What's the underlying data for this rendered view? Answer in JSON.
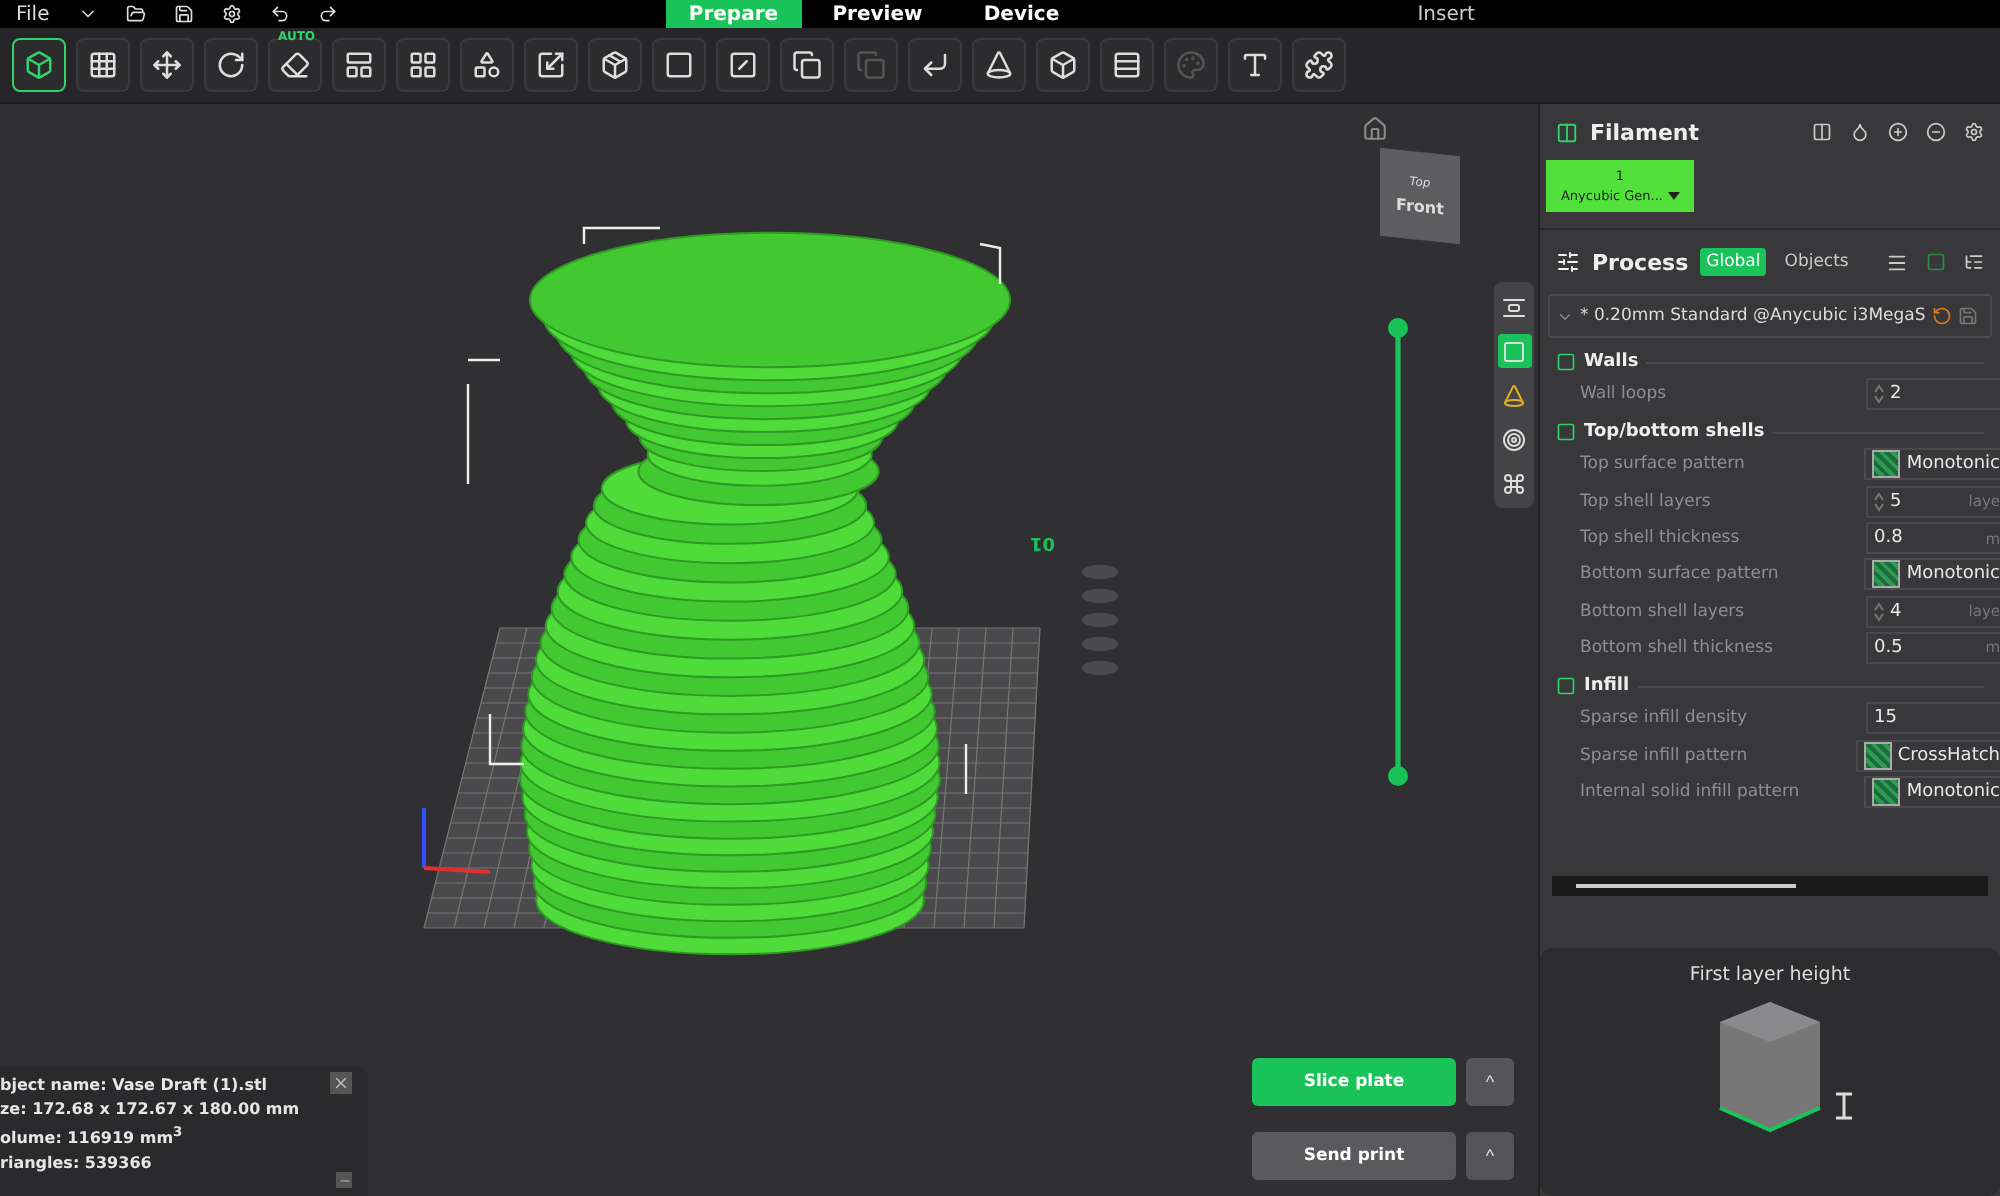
{
  "menu_bar": {
    "file_menu": "File",
    "tabs": [
      {
        "label": "Prepare",
        "selected": true
      },
      {
        "label": "Preview",
        "selected": false
      },
      {
        "label": "Device",
        "selected": false
      }
    ],
    "insert": "Insert"
  },
  "toolbar": [
    {
      "selected": true
    },
    {
      "selected": false
    },
    {
      "selected": false
    },
    {
      "selected": false
    },
    {
      "selected": false,
      "badge": "AUTO"
    },
    {
      "selected": false
    },
    {
      "selected": false
    },
    {
      "selected": false
    },
    {
      "selected": false
    },
    {
      "selected": false
    },
    {
      "selected": false
    },
    {
      "selected": false
    },
    {
      "selected": false
    },
    {
      "selected": false,
      "disabled": true
    },
    {
      "selected": false
    },
    {
      "selected": false
    },
    {
      "selected": false
    },
    {
      "selected": false
    },
    {
      "selected": false,
      "disabled": true
    },
    {
      "selected": false
    },
    {
      "selected": false
    }
  ],
  "viewport": {
    "view_cube": {
      "top": "Top",
      "front": "Front"
    },
    "plate_number": "01",
    "layer_slider": {
      "level": 1
    },
    "side_toolbar": [
      {
        "selected": false
      },
      {
        "selected": true
      },
      {
        "selected": false
      },
      {
        "selected": false
      },
      {
        "selected": false
      }
    ],
    "object_info": [
      "bject name: Vase Draft (1).stl",
      "ze: 172.68 x 172.67 x 180.00 mm",
      "olume: 116919 mm$^{3}$",
      "riangles: 539366"
    ],
    "actions": [
      {
        "label": "Slice plate",
        "primary": true,
        "more": "^"
      },
      {
        "label": "Send print",
        "primary": false,
        "more": "^"
      }
    ]
  },
  "filament": {
    "title": "Filament",
    "slots": [
      {
        "index": "1",
        "name": "Anycubic Gen...",
        "color": "#52e03a"
      }
    ]
  },
  "process": {
    "title": "Process",
    "tabs": [
      {
        "label": "Global",
        "selected": true
      },
      {
        "label": "Objects",
        "selected": false
      }
    ],
    "preset": "* 0.20mm Standard @Anycubic i3MegaS",
    "sections": [
      {
        "title": "Walls",
        "rows": [
          {
            "kind": "stepper",
            "label": "Wall loops",
            "value": "2"
          }
        ]
      },
      {
        "title": "Top/bottom shells",
        "rows": [
          {
            "kind": "pattern",
            "label": "Top surface pattern",
            "value": "Monotonic"
          },
          {
            "kind": "stepper",
            "label": "Top shell layers",
            "value": "5",
            "unit": "laye"
          },
          {
            "kind": "number",
            "label": "Top shell thickness",
            "value": "0.8",
            "unit": "m"
          },
          {
            "kind": "pattern",
            "label": "Bottom surface pattern",
            "value": "Monotonic"
          },
          {
            "kind": "stepper",
            "label": "Bottom shell layers",
            "value": "4",
            "unit": "laye"
          },
          {
            "kind": "number",
            "label": "Bottom shell thickness",
            "value": "0.5",
            "unit": "m"
          }
        ]
      },
      {
        "title": "Infill",
        "rows": [
          {
            "kind": "number",
            "label": "Sparse infill density",
            "value": "15"
          },
          {
            "kind": "pattern",
            "label": "Sparse infill pattern",
            "value": "CrossHatch"
          },
          {
            "kind": "pattern",
            "label": "Internal solid infill pattern",
            "value": "Monotonic"
          }
        ]
      }
    ]
  },
  "hint_card": {
    "title": "First layer height"
  }
}
